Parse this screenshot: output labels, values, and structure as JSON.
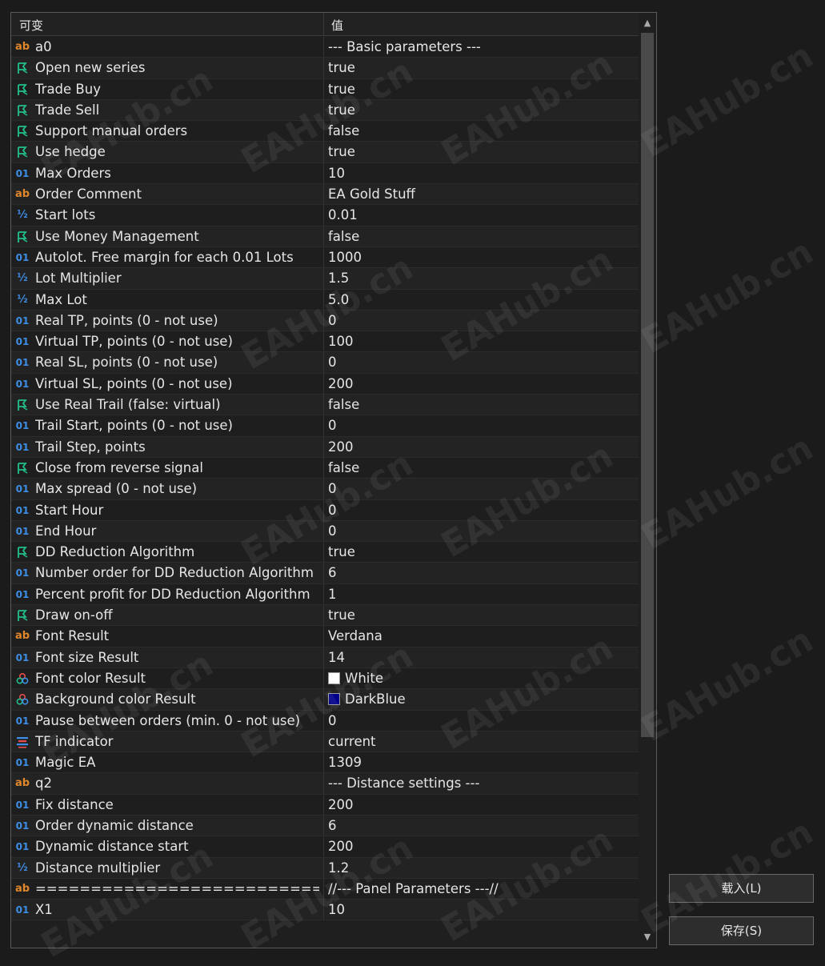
{
  "header": {
    "col_name": "可变",
    "col_value": "值"
  },
  "rows": [
    {
      "icon": "string",
      "name": "a0",
      "value": "--- Basic parameters ---"
    },
    {
      "icon": "bool",
      "name": "Open new series",
      "value": "true"
    },
    {
      "icon": "bool",
      "name": "Trade Buy",
      "value": "true"
    },
    {
      "icon": "bool",
      "name": "Trade Sell",
      "value": "true"
    },
    {
      "icon": "bool",
      "name": "Support manual orders",
      "value": "false"
    },
    {
      "icon": "bool",
      "name": "Use hedge",
      "value": "true"
    },
    {
      "icon": "int",
      "name": "Max Orders",
      "value": "10"
    },
    {
      "icon": "string",
      "name": "Order Comment",
      "value": "EA Gold Stuff"
    },
    {
      "icon": "double",
      "name": "Start lots",
      "value": "0.01"
    },
    {
      "icon": "bool",
      "name": "Use Money Management",
      "value": "false"
    },
    {
      "icon": "int",
      "name": "Autolot. Free margin for each 0.01 Lots",
      "value": "1000"
    },
    {
      "icon": "double",
      "name": "Lot Multiplier",
      "value": "1.5"
    },
    {
      "icon": "double",
      "name": "Max Lot",
      "value": "5.0"
    },
    {
      "icon": "int",
      "name": "Real TP, points (0 - not use)",
      "value": "0"
    },
    {
      "icon": "int",
      "name": "Virtual TP, points (0 - not use)",
      "value": "100"
    },
    {
      "icon": "int",
      "name": "Real SL, points (0 - not use)",
      "value": "0"
    },
    {
      "icon": "int",
      "name": "Virtual SL, points (0 - not use)",
      "value": "200"
    },
    {
      "icon": "bool",
      "name": "Use Real Trail (false: virtual)",
      "value": "false"
    },
    {
      "icon": "int",
      "name": "Trail Start, points (0 - not use)",
      "value": "0"
    },
    {
      "icon": "int",
      "name": "Trail Step, points",
      "value": "200"
    },
    {
      "icon": "bool",
      "name": "Close from reverse signal",
      "value": "false"
    },
    {
      "icon": "int",
      "name": "Max spread (0 - not use)",
      "value": "0"
    },
    {
      "icon": "int",
      "name": "Start Hour",
      "value": "0"
    },
    {
      "icon": "int",
      "name": "End Hour",
      "value": "0"
    },
    {
      "icon": "bool",
      "name": "DD Reduction Algorithm",
      "value": "true"
    },
    {
      "icon": "int",
      "name": "Number order for DD Reduction Algorithm",
      "value": "6"
    },
    {
      "icon": "int",
      "name": "Percent profit for DD Reduction Algorithm",
      "value": "1"
    },
    {
      "icon": "bool",
      "name": "Draw on-off",
      "value": "true"
    },
    {
      "icon": "string",
      "name": "Font Result",
      "value": "Verdana"
    },
    {
      "icon": "int",
      "name": "Font size Result",
      "value": "14"
    },
    {
      "icon": "color",
      "name": "Font color Result",
      "value": "White",
      "swatch": "#ffffff"
    },
    {
      "icon": "color",
      "name": "Background color Result",
      "value": "DarkBlue",
      "swatch": "#00008b"
    },
    {
      "icon": "int",
      "name": "Pause between orders (min. 0 - not use)",
      "value": "0"
    },
    {
      "icon": "tf",
      "name": "TF indicator",
      "value": "current"
    },
    {
      "icon": "int",
      "name": "Magic EA",
      "value": "1309"
    },
    {
      "icon": "string",
      "name": "q2",
      "value": "--- Distance settings ---"
    },
    {
      "icon": "int",
      "name": "Fix distance",
      "value": "200"
    },
    {
      "icon": "int",
      "name": "Order dynamic distance",
      "value": "6"
    },
    {
      "icon": "int",
      "name": "Dynamic distance start",
      "value": "200"
    },
    {
      "icon": "double",
      "name": "Distance multiplier",
      "value": "1.2"
    },
    {
      "icon": "string",
      "name": "===========================...",
      "value": "//--- Panel Parameters ---//"
    },
    {
      "icon": "int",
      "name": "X1",
      "value": "10"
    }
  ],
  "icon_glyphs": {
    "string": "ab",
    "int": "01",
    "double": "½"
  },
  "colors": {
    "bool_icon": "#22c08a",
    "int_icon": "#3d8ee6",
    "string_icon": "#e0872c"
  },
  "buttons": {
    "load": "载入(L)",
    "save": "保存(S)"
  },
  "watermark": "EAHub.cn"
}
